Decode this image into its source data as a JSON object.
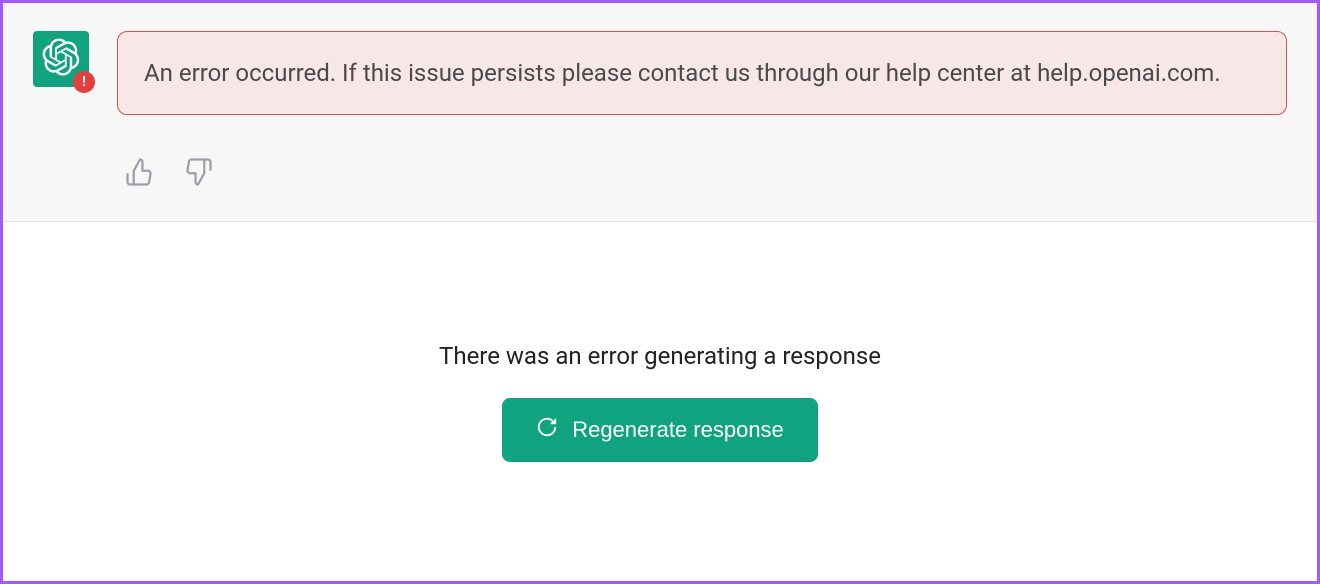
{
  "message": {
    "error_text": "An error occurred. If this issue persists please contact us through our help center at help.openai.com.",
    "avatar_icon": "openai-logo",
    "avatar_badge": "!"
  },
  "feedback": {
    "thumbs_up": "thumbs-up-icon",
    "thumbs_down": "thumbs-down-icon"
  },
  "footer": {
    "error_generating": "There was an error generating a response",
    "regenerate_label": "Regenerate response",
    "regenerate_icon": "refresh-icon"
  },
  "colors": {
    "accent": "#10a37f",
    "error_border": "#d9534f",
    "error_bg": "#f8e7e7",
    "frame": "#a259ff"
  }
}
